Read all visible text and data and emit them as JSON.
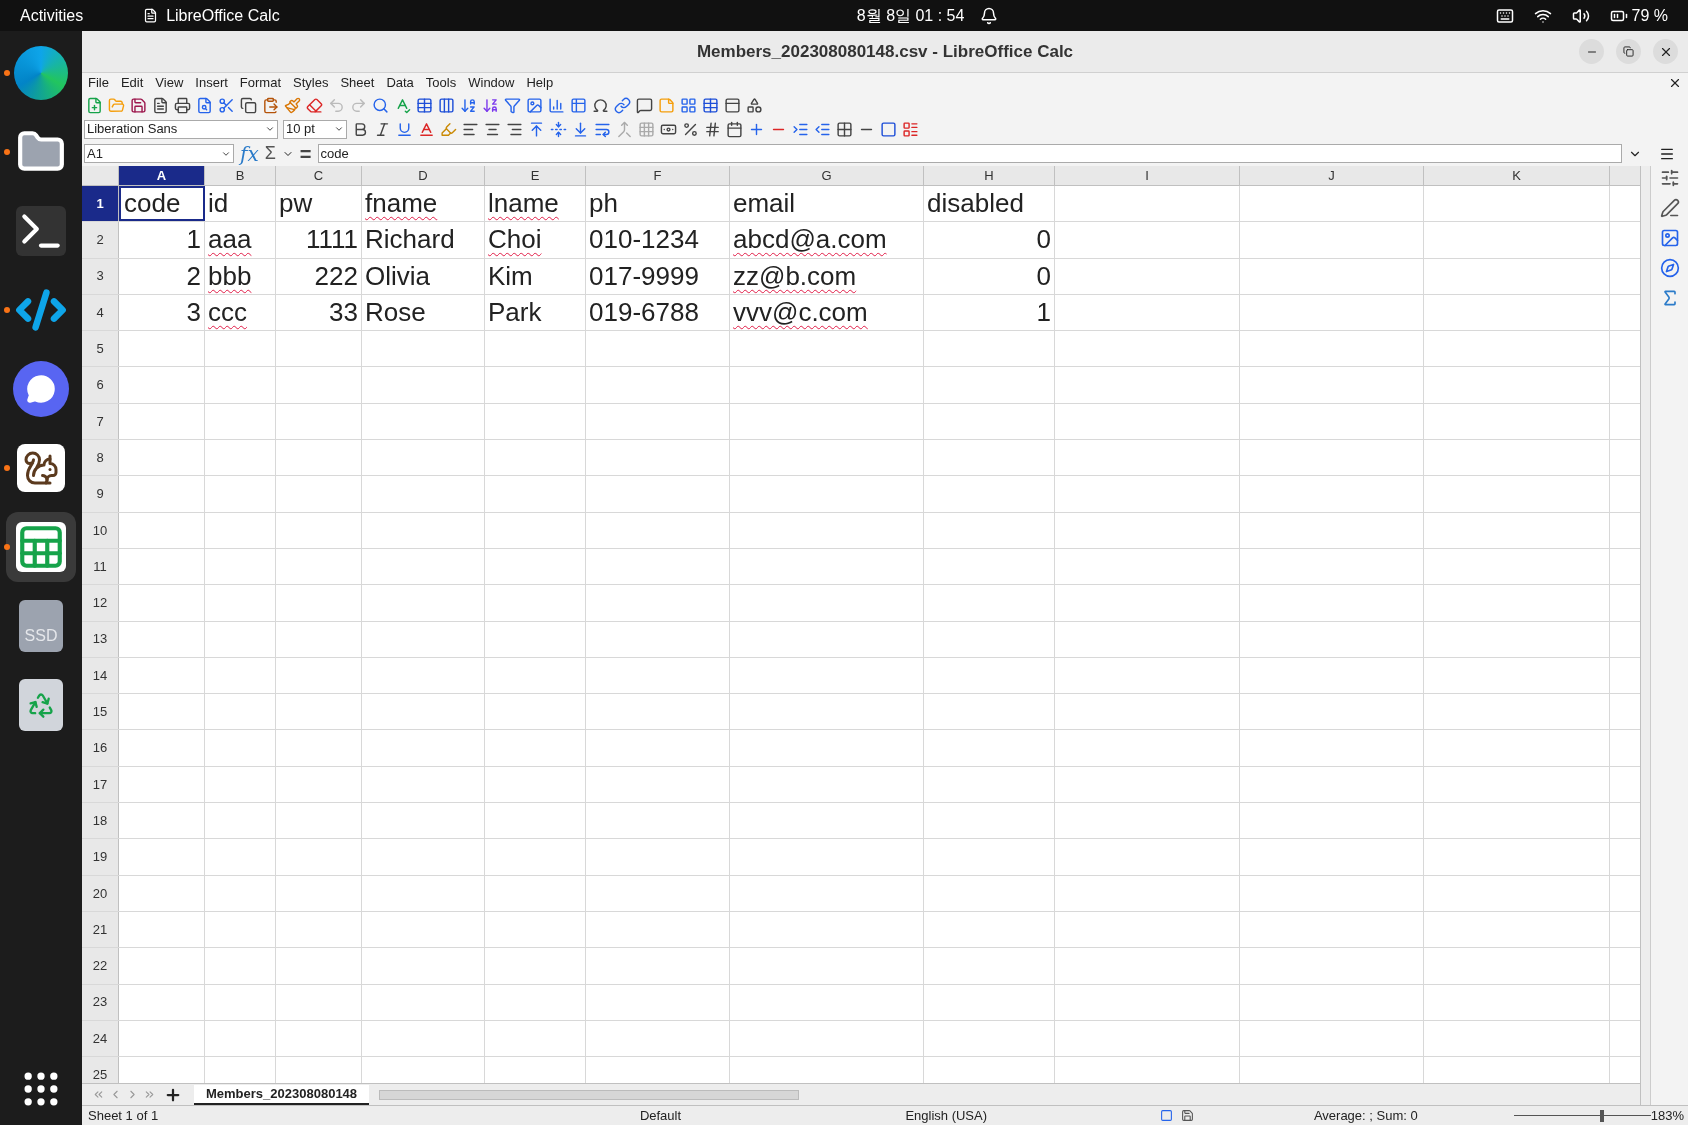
{
  "top_bar": {
    "activities": "Activities",
    "app_name": "LibreOffice Calc",
    "clock": "8월 8일 01 : 54",
    "battery": "79 %"
  },
  "dock": [
    {
      "kind": "browser",
      "running": true,
      "selected": false
    },
    {
      "kind": "files",
      "running": true,
      "selected": false
    },
    {
      "kind": "terminal",
      "running": false,
      "selected": false
    },
    {
      "kind": "editor",
      "running": true,
      "selected": false
    },
    {
      "kind": "chat",
      "running": false,
      "selected": false
    },
    {
      "kind": "squirrel",
      "running": true,
      "selected": false
    },
    {
      "kind": "calc",
      "running": true,
      "selected": true
    },
    {
      "kind": "drive",
      "running": false,
      "selected": false,
      "label": "SSD"
    },
    {
      "kind": "trash",
      "running": false,
      "selected": false
    }
  ],
  "window": {
    "title": "Members_202308080148.csv - LibreOffice Calc"
  },
  "menu": [
    "File",
    "Edit",
    "View",
    "Insert",
    "Format",
    "Styles",
    "Sheet",
    "Data",
    "Tools",
    "Window",
    "Help"
  ],
  "formatting": {
    "font_name": "Liberation Sans",
    "font_size": "10 pt"
  },
  "formula_bar": {
    "cell_ref": "A1",
    "function_wizard": "fx",
    "sum": "Σ",
    "equals": "=",
    "content": "code"
  },
  "columns": [
    {
      "label": "A",
      "selected": true
    },
    {
      "label": "B",
      "selected": false
    },
    {
      "label": "C",
      "selected": false
    },
    {
      "label": "D",
      "selected": false
    },
    {
      "label": "E",
      "selected": false
    },
    {
      "label": "F",
      "selected": false
    },
    {
      "label": "G",
      "selected": false
    },
    {
      "label": "H",
      "selected": false
    },
    {
      "label": "I",
      "selected": false
    },
    {
      "label": "J",
      "selected": false
    },
    {
      "label": "K",
      "selected": false
    }
  ],
  "rows": [
    {
      "number": "1",
      "selected": true,
      "cells": [
        {
          "text": "code",
          "kind": "text",
          "misspelled": false,
          "selected": true
        },
        {
          "text": "id",
          "kind": "text",
          "misspelled": false,
          "selected": false
        },
        {
          "text": "pw",
          "kind": "text",
          "misspelled": false,
          "selected": false
        },
        {
          "text": "fname",
          "kind": "text",
          "misspelled": true,
          "selected": false
        },
        {
          "text": "lname",
          "kind": "text",
          "misspelled": true,
          "selected": false
        },
        {
          "text": "ph",
          "kind": "text",
          "misspelled": false,
          "selected": false
        },
        {
          "text": "email",
          "kind": "text",
          "misspelled": false,
          "selected": false
        },
        {
          "text": "disabled",
          "kind": "text",
          "misspelled": false,
          "selected": false
        }
      ]
    },
    {
      "number": "2",
      "selected": false,
      "cells": [
        {
          "text": "1",
          "kind": "number",
          "misspelled": false,
          "selected": false
        },
        {
          "text": "aaa",
          "kind": "text",
          "misspelled": true,
          "selected": false
        },
        {
          "text": "1111",
          "kind": "number",
          "misspelled": false,
          "selected": false
        },
        {
          "text": "Richard",
          "kind": "text",
          "misspelled": false,
          "selected": false
        },
        {
          "text": "Choi",
          "kind": "text",
          "misspelled": true,
          "selected": false
        },
        {
          "text": "010-1234",
          "kind": "text",
          "misspelled": false,
          "selected": false
        },
        {
          "text": "abcd@a.com",
          "kind": "text",
          "misspelled": true,
          "selected": false
        },
        {
          "text": "0",
          "kind": "number",
          "misspelled": false,
          "selected": false
        }
      ]
    },
    {
      "number": "3",
      "selected": false,
      "cells": [
        {
          "text": "2",
          "kind": "number",
          "misspelled": false,
          "selected": false
        },
        {
          "text": "bbb",
          "kind": "text",
          "misspelled": true,
          "selected": false
        },
        {
          "text": "222",
          "kind": "number",
          "misspelled": false,
          "selected": false
        },
        {
          "text": "Olivia",
          "kind": "text",
          "misspelled": false,
          "selected": false
        },
        {
          "text": "Kim",
          "kind": "text",
          "misspelled": false,
          "selected": false
        },
        {
          "text": "017-9999",
          "kind": "text",
          "misspelled": false,
          "selected": false
        },
        {
          "text": "zz@b.com",
          "kind": "text",
          "misspelled": true,
          "selected": false
        },
        {
          "text": "0",
          "kind": "number",
          "misspelled": false,
          "selected": false
        }
      ]
    },
    {
      "number": "4",
      "selected": false,
      "cells": [
        {
          "text": "3",
          "kind": "number",
          "misspelled": false,
          "selected": false
        },
        {
          "text": "ccc",
          "kind": "text",
          "misspelled": true,
          "selected": false
        },
        {
          "text": "33",
          "kind": "number",
          "misspelled": false,
          "selected": false
        },
        {
          "text": "Rose",
          "kind": "text",
          "misspelled": false,
          "selected": false
        },
        {
          "text": "Park",
          "kind": "text",
          "misspelled": false,
          "selected": false
        },
        {
          "text": "019-6788",
          "kind": "text",
          "misspelled": false,
          "selected": false
        },
        {
          "text": "vvv@c.com",
          "kind": "text",
          "misspelled": true,
          "selected": false
        },
        {
          "text": "1",
          "kind": "number",
          "misspelled": false,
          "selected": false
        }
      ]
    },
    {
      "number": "5",
      "selected": false
    },
    {
      "number": "6",
      "selected": false
    },
    {
      "number": "7",
      "selected": false
    },
    {
      "number": "8",
      "selected": false
    },
    {
      "number": "9",
      "selected": false
    },
    {
      "number": "10",
      "selected": false
    },
    {
      "number": "11",
      "selected": false
    },
    {
      "number": "12",
      "selected": false
    },
    {
      "number": "13",
      "selected": false
    },
    {
      "number": "14",
      "selected": false
    },
    {
      "number": "15",
      "selected": false
    },
    {
      "number": "16",
      "selected": false
    },
    {
      "number": "17",
      "selected": false
    },
    {
      "number": "18",
      "selected": false
    },
    {
      "number": "19",
      "selected": false
    },
    {
      "number": "20",
      "selected": false
    },
    {
      "number": "21",
      "selected": false
    },
    {
      "number": "22",
      "selected": false
    },
    {
      "number": "23",
      "selected": false
    },
    {
      "number": "24",
      "selected": false
    },
    {
      "number": "25",
      "selected": false
    }
  ],
  "sheet_tabs": [
    {
      "label": "Members_202308080148",
      "selected": true
    }
  ],
  "status_bar": {
    "sheet": "Sheet 1 of 1",
    "page_style": "Default",
    "language": "English (USA)",
    "summary": "Average: ; Sum: 0",
    "zoom": "183%",
    "zoom_slider": {
      "level": 0.64
    }
  }
}
